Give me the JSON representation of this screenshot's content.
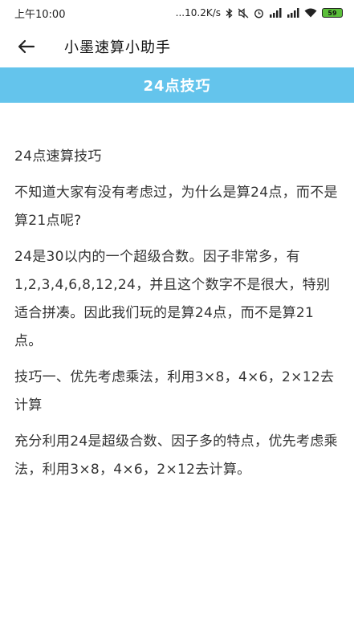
{
  "status_bar": {
    "time": "上午10:00",
    "network_speed": "...10.2K/s",
    "battery_level": "59",
    "icons": [
      "bluetooth-icon",
      "mute-icon",
      "alarm-icon",
      "signal-icon",
      "signal-icon",
      "wifi-icon",
      "battery-icon"
    ]
  },
  "app_bar": {
    "back_icon": "arrow-left-icon",
    "title": "小墨速算小助手"
  },
  "header": {
    "title": "24点技巧",
    "color": "#64c4ec"
  },
  "article": {
    "paragraphs": [
      "24点速算技巧",
      "不知道大家有没有考虑过，为什么是算24点，而不是算21点呢?",
      "24是30以内的一个超级合数。因子非常多，有1,2,3,4,6,8,12,24，并且这个数字不是很大，特别适合拼凑。因此我们玩的是算24点，而不是算21点。",
      "技巧一、优先考虑乘法，利用3×8，4×6，2×12去计算",
      "充分利用24是超级合数、因子多的特点，优先考虑乘法，利用3×8，4×6，2×12去计算。"
    ]
  }
}
